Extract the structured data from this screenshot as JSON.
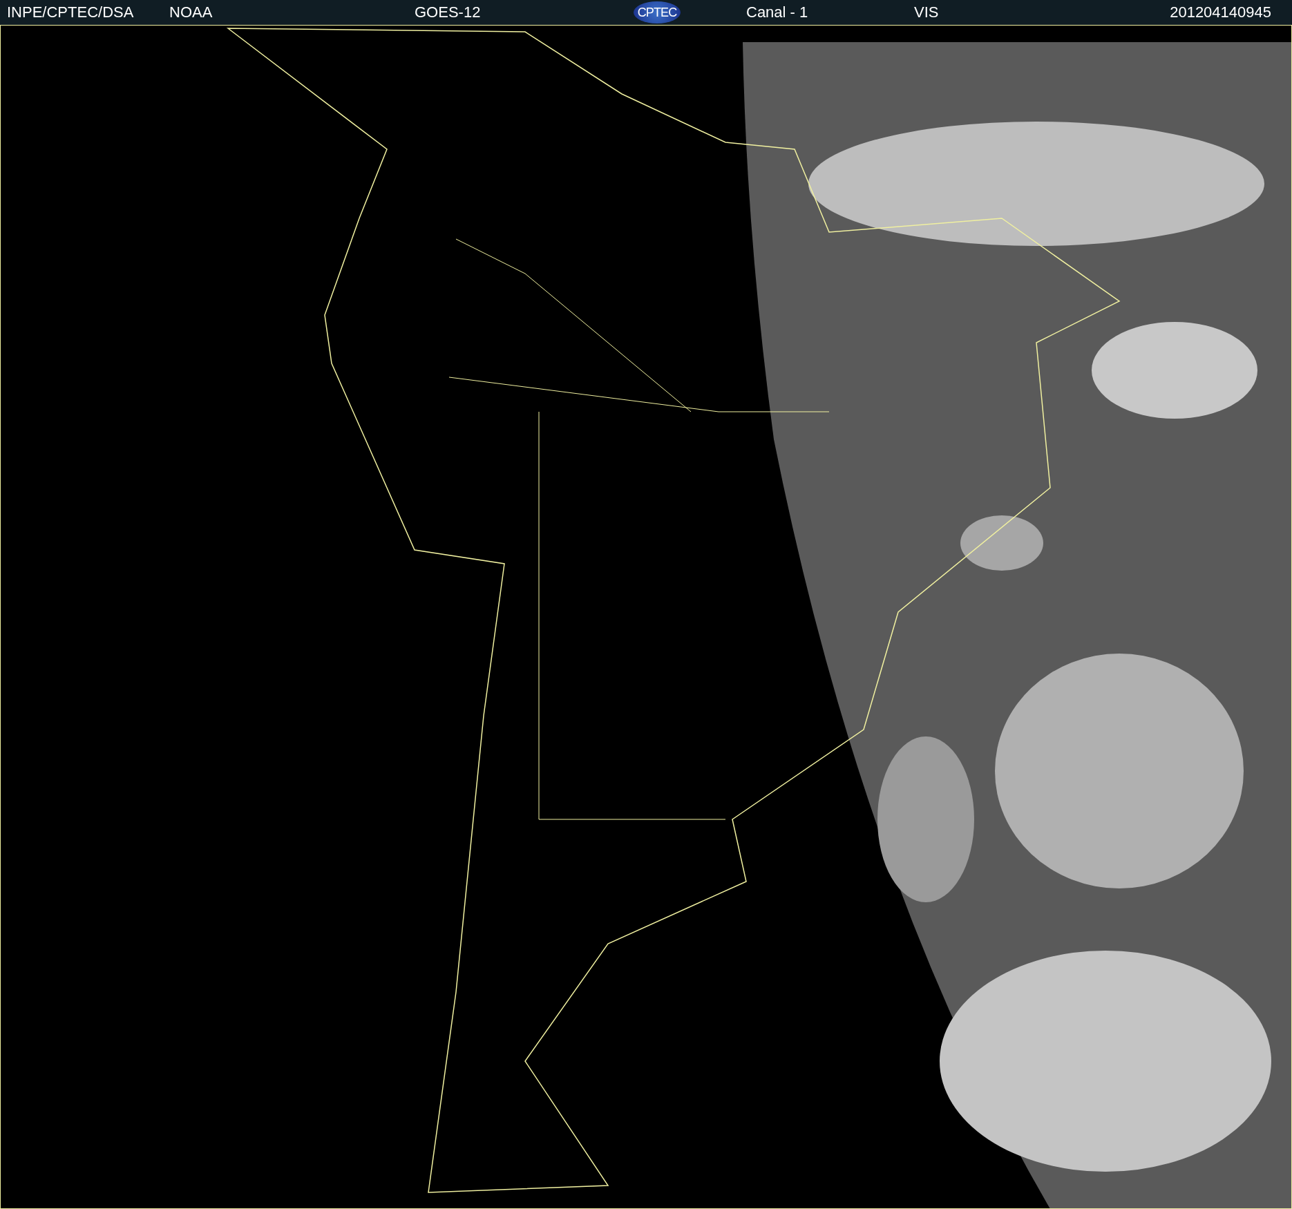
{
  "header": {
    "agency": "INPE/CPTEC/DSA",
    "source": "NOAA",
    "satellite": "GOES-12",
    "logo": "CPTEC",
    "channel": "Canal - 1",
    "band": "VIS",
    "timestamp": "201204140945"
  }
}
